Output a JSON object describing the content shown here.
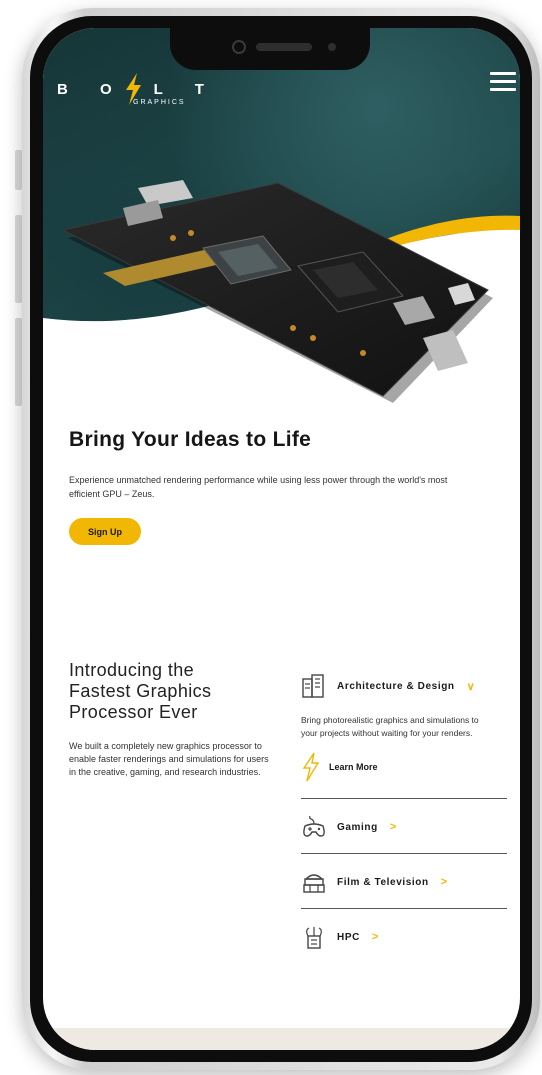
{
  "brand": {
    "logo_text": "B O L T",
    "logo_sub": "GRAPHICS",
    "accent_color": "#f2b705"
  },
  "hero": {
    "title": "Bring Your Ideas to Life",
    "description": "Experience unmatched rendering performance while using less power through the world's most efficient GPU – Zeus.",
    "cta_label": "Sign Up"
  },
  "intro": {
    "title": "Introducing the Fastest Graphics Processor Ever",
    "description": "We built a completely new graphics processor to enable faster renderings and simulations for users in the creative, gaming, and research industries."
  },
  "accordion": {
    "items": [
      {
        "label": "Architecture & Design",
        "icon": "building-icon",
        "expanded": true,
        "body": "Bring photorealistic graphics and simulations to your projects without waiting for your renders.",
        "link_label": "Learn More"
      },
      {
        "label": "Gaming",
        "icon": "gamepad-icon",
        "expanded": false
      },
      {
        "label": "Film & Television",
        "icon": "film-icon",
        "expanded": false
      },
      {
        "label": "HPC",
        "icon": "server-icon",
        "expanded": false
      }
    ]
  }
}
